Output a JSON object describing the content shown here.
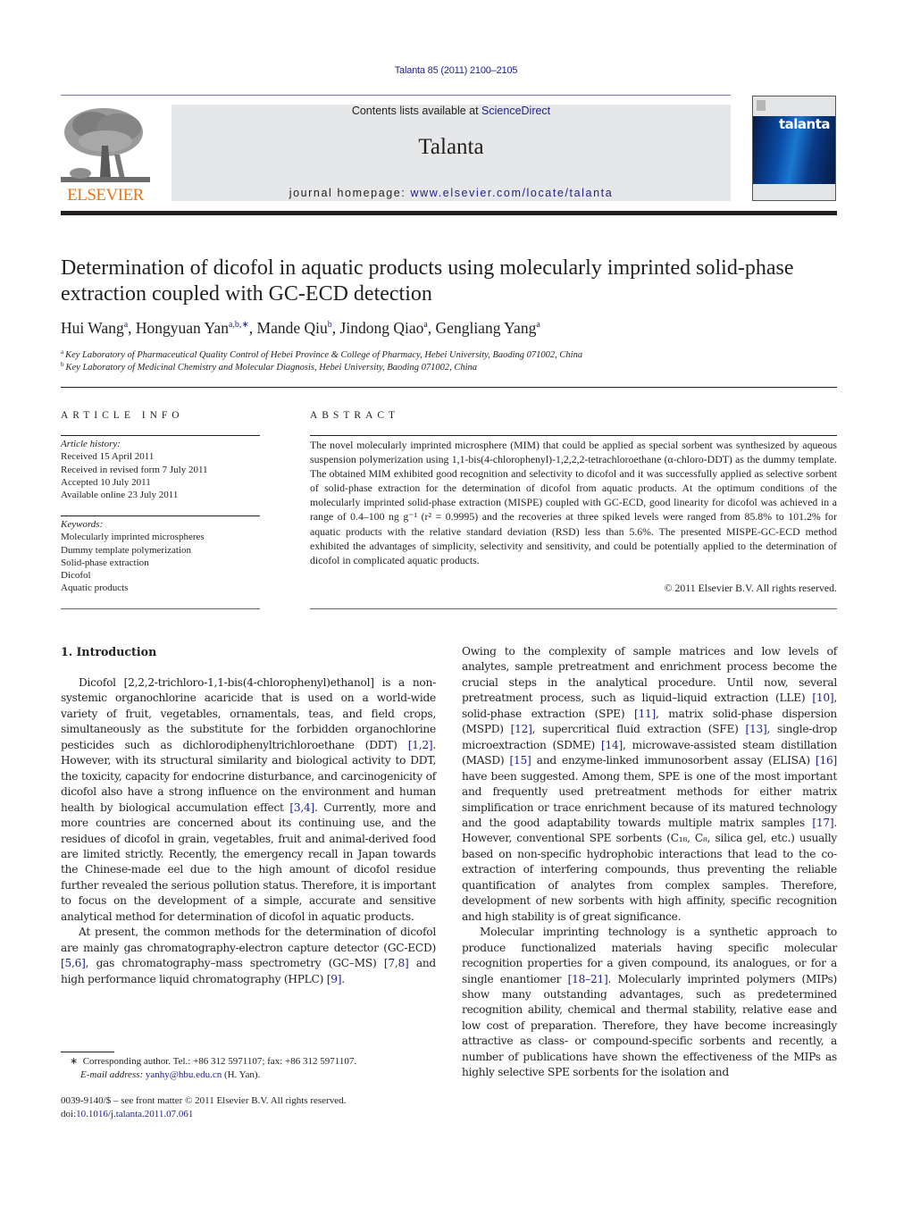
{
  "header": {
    "citation": "Talanta 85 (2011) 2100–2105",
    "contents_prefix": "Contents lists available at ",
    "contents_link": "ScienceDirect",
    "journal_name": "Talanta",
    "homepage_prefix": "journal homepage: ",
    "homepage_link": "www.elsevier.com/locate/talanta",
    "publisher_logo_text": "ELSEVIER",
    "cover_title": "talanta",
    "colors": {
      "link": "#1f1f8f",
      "publisher_orange": "#e8761a",
      "banner_gray": "#e6e7e8"
    }
  },
  "article": {
    "title": "Determination of dicofol in aquatic products using molecularly imprinted solid-phase extraction coupled with GC-ECD detection",
    "authors": [
      {
        "name": "Hui Wang",
        "sup": "a",
        "sep": ", "
      },
      {
        "name": "Hongyuan Yan",
        "sup": "a,b,∗",
        "sep": ", "
      },
      {
        "name": "Mande Qiu",
        "sup": "b",
        "sep": ", "
      },
      {
        "name": "Jindong Qiao",
        "sup": "a",
        "sep": ", "
      },
      {
        "name": "Gengliang Yang",
        "sup": "a",
        "sep": ""
      }
    ],
    "affiliations": [
      {
        "mark": "a",
        "text": "Key Laboratory of Pharmaceutical Quality Control of Hebei Province & College of Pharmacy, Hebei University, Baoding 071002, China"
      },
      {
        "mark": "b",
        "text": "Key Laboratory of Medicinal Chemistry and Molecular Diagnosis, Hebei University, Baoding 071002, China"
      }
    ]
  },
  "article_info": {
    "heading": "ARTICLE INFO",
    "history_label": "Article history:",
    "history": [
      "Received 15 April 2011",
      "Received in revised form 7 July 2011",
      "Accepted 10 July 2011",
      "Available online 23 July 2011"
    ],
    "keywords_label": "Keywords:",
    "keywords": [
      "Molecularly imprinted microspheres",
      "Dummy template polymerization",
      "Solid-phase extraction",
      "Dicofol",
      "Aquatic products"
    ]
  },
  "abstract": {
    "heading": "ABSTRACT",
    "text": "The novel molecularly imprinted microsphere (MIM) that could be applied as special sorbent was synthesized by aqueous suspension polymerization using 1,1-bis(4-chlorophenyl)-1,2,2,2-tetrachloroethane (α-chloro-DDT) as the dummy template. The obtained MIM exhibited good recognition and selectivity to dicofol and it was successfully applied as selective sorbent of solid-phase extraction for the determination of dicofol from aquatic products. At the optimum conditions of the molecularly imprinted solid-phase extraction (MISPE) coupled with GC-ECD, good linearity for dicofol was achieved in a range of 0.4–100 ng g⁻¹ (r² = 0.9995) and the recoveries at three spiked levels were ranged from 85.8% to 101.2% for aquatic products with the relative standard deviation (RSD) less than 5.6%. The presented MISPE-GC-ECD method exhibited the advantages of simplicity, selectivity and sensitivity, and could be potentially applied to the determination of dicofol in complicated aquatic products.",
    "copyright": "© 2011 Elsevier B.V. All rights reserved."
  },
  "body": {
    "section_heading": "1.  Introduction",
    "left_paragraphs": [
      [
        {
          "t": "Dicofol [2,2,2-trichloro-1,1-bis(4-chlorophenyl)ethanol] is a non-systemic organochlorine acaricide that is used on a world-wide variety of fruit, vegetables, ornamentals, teas, and field crops, simultaneously as the substitute for the forbidden organochlorine pesticides such as dichlorodiphenyltrichloroethane (DDT) "
        },
        {
          "ref": "[1,2]"
        },
        {
          "t": ". However, with its structural similarity and biological activity to DDT, the toxicity, capacity for endocrine disturbance, and carcinogenicity of dicofol also have a strong influence on the environment and human health by biological accumulation effect "
        },
        {
          "ref": "[3,4]"
        },
        {
          "t": ". Currently, more and more countries are concerned about its continuing use, and the residues of dicofol in grain, vegetables, fruit and animal-derived food are limited strictly. Recently, the emergency recall in Japan towards the Chinese-made eel due to the high amount of dicofol residue further revealed the serious pollution status. Therefore, it is important to focus on the development of a simple, accurate and sensitive analytical method for determination of dicofol in aquatic products."
        }
      ],
      [
        {
          "t": "At present, the common methods for the determination of dicofol are mainly gas chromatography-electron capture detector (GC-ECD) "
        },
        {
          "ref": "[5,6]"
        },
        {
          "t": ", gas chromatography–mass spectrometry (GC–MS) "
        },
        {
          "ref": "[7,8]"
        },
        {
          "t": " and high performance liquid chromatography (HPLC) "
        },
        {
          "ref": "[9]"
        },
        {
          "t": "."
        }
      ]
    ],
    "right_paragraphs": [
      [
        {
          "t": "Owing to the complexity of sample matrices and low levels of analytes, sample pretreatment and enrichment process become the crucial steps in the analytical procedure. Until now, several pretreatment process, such as liquid–liquid extraction (LLE) "
        },
        {
          "ref": "[10]"
        },
        {
          "t": ", solid-phase extraction (SPE) "
        },
        {
          "ref": "[11]"
        },
        {
          "t": ", matrix solid-phase dispersion (MSPD) "
        },
        {
          "ref": "[12]"
        },
        {
          "t": ", supercritical fluid extraction (SFE) "
        },
        {
          "ref": "[13]"
        },
        {
          "t": ", single-drop microextraction (SDME) "
        },
        {
          "ref": "[14]"
        },
        {
          "t": ", microwave-assisted steam distillation (MASD) "
        },
        {
          "ref": "[15]"
        },
        {
          "t": " and enzyme-linked immunosorbent assay (ELISA) "
        },
        {
          "ref": "[16]"
        },
        {
          "t": " have been suggested. Among them, SPE is one of the most important and frequently used pretreatment methods for either matrix simplification or trace enrichment because of its matured technology and the good adaptability towards multiple matrix samples "
        },
        {
          "ref": "[17]"
        },
        {
          "t": ". However, conventional SPE sorbents (C₁₈, C₈, silica gel, etc.) usually based on non-specific hydrophobic interactions that lead to the co-extraction of interfering compounds, thus preventing the reliable quantification of analytes from complex samples. Therefore, development of new sorbents with high affinity, specific recognition and high stability is of great significance."
        }
      ],
      [
        {
          "t": "Molecular imprinting technology is a synthetic approach to produce functionalized materials having specific molecular recognition properties for a given compound, its analogues, or for a single enantiomer "
        },
        {
          "ref": "[18–21]"
        },
        {
          "t": ". Molecularly imprinted polymers (MIPs) show many outstanding advantages, such as predetermined recognition ability, chemical and thermal stability, relative ease and low cost of preparation. Therefore, they have become increasingly attractive as class- or compound-specific sorbents and recently, a number of publications have shown the effectiveness of the MIPs as highly selective SPE sorbents for the isolation and"
        }
      ]
    ]
  },
  "footnotes": {
    "corresponding_mark": "∗",
    "corresponding_text": "Corresponding author. Tel.: +86 312 5971107; fax: +86 312 5971107.",
    "email_label": "E-mail address:",
    "email": "yanhy@hbu.edu.cn",
    "email_suffix": " (H. Yan).",
    "issn_line": "0039-9140/$ – see front matter © 2011 Elsevier B.V. All rights reserved.",
    "doi_prefix": "doi:",
    "doi": "10.1016/j.talanta.2011.07.061"
  }
}
